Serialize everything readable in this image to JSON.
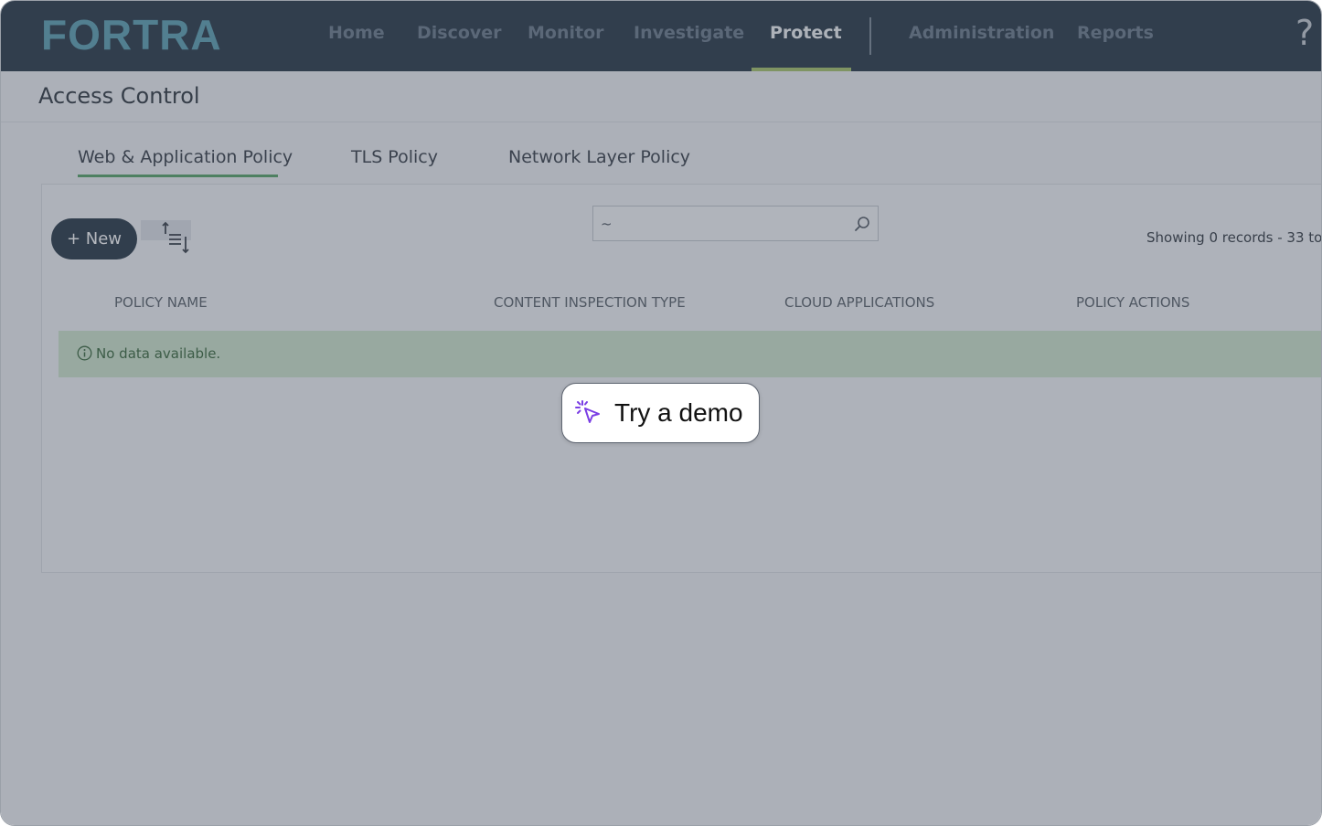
{
  "brand": {
    "logo_text": "FORTRA",
    "logo_color": "#5fa3b5",
    "nav_bg": "#2b3a4a",
    "accent": "#a8c66c"
  },
  "nav": {
    "items": [
      {
        "label": "Home",
        "active": false
      },
      {
        "label": "Discover",
        "active": false
      },
      {
        "label": "Monitor",
        "active": false
      },
      {
        "label": "Investigate",
        "active": false
      },
      {
        "label": "Protect",
        "active": true
      },
      {
        "label": "Administration",
        "active": false
      },
      {
        "label": "Reports",
        "active": false
      }
    ],
    "help_label": "?"
  },
  "page": {
    "title": "Access Control"
  },
  "tabs": [
    {
      "label": "Web & Application Policy",
      "active": true
    },
    {
      "label": "TLS Policy",
      "active": false
    },
    {
      "label": "Network Layer Policy",
      "active": false
    }
  ],
  "toolbar": {
    "new_label": "+ New",
    "sort_icon": "sort-order-icon",
    "search_value": "~",
    "search_icon": "search-icon",
    "records_text": "Showing 0 records - 33 to"
  },
  "table": {
    "columns": [
      "POLICY NAME",
      "CONTENT INSPECTION TYPE",
      "CLOUD APPLICATIONS",
      "POLICY ACTIONS"
    ],
    "empty_message": "No data available.",
    "empty_icon": "info-icon"
  },
  "demo": {
    "label": "Try a demo",
    "icon": "sparkle-cursor-icon",
    "icon_color": "#7b3fe4"
  }
}
